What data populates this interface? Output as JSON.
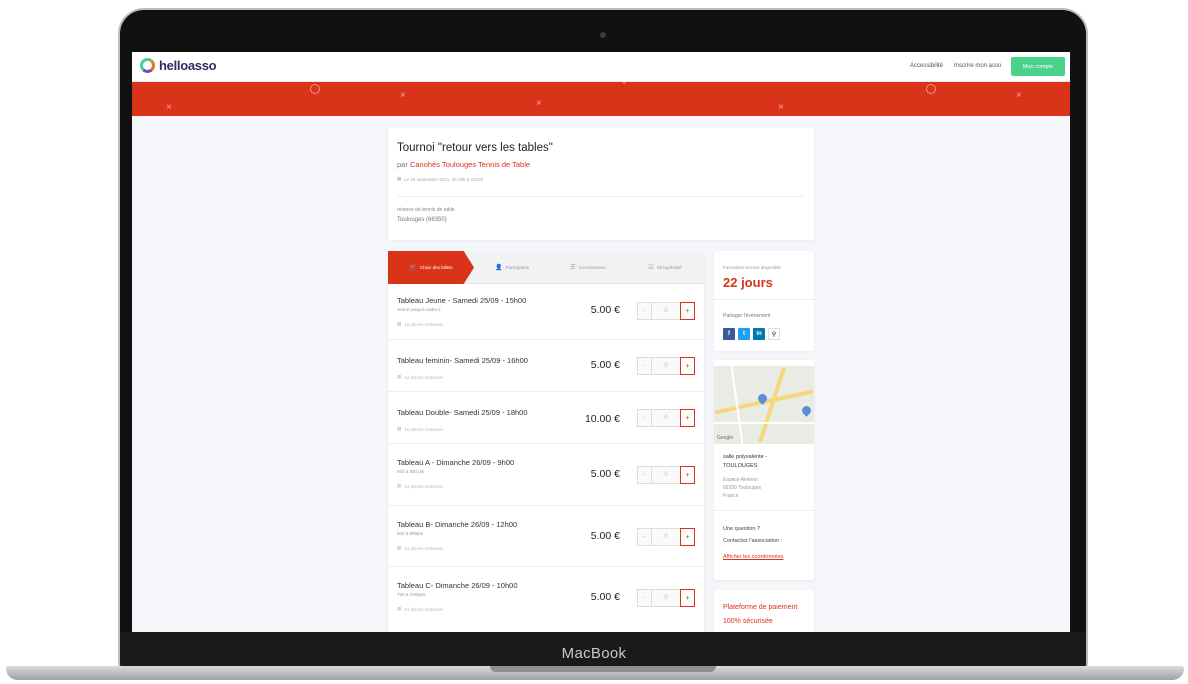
{
  "device": {
    "label": "MacBook"
  },
  "header": {
    "logo_text": "helloasso",
    "links": [
      "Accessibilité",
      "Inscrire mon asso"
    ],
    "account_button": "Mon compte"
  },
  "event": {
    "title": "Tournoi \"retour vers les tables\"",
    "organizer_prefix": "par",
    "organizer": "Canohès Toulouges Tennis de Table",
    "date": "Le 25 septembre 2021, de 09h à 23h30",
    "venue_line1": "réserve de tennis de table",
    "venue_line2": "Toulouges (66350)"
  },
  "tabs": [
    {
      "label": "Choix des billets",
      "icon": "cart-icon"
    },
    {
      "label": "Participants",
      "icon": "user-icon"
    },
    {
      "label": "Coordonnées",
      "icon": "list-icon"
    },
    {
      "label": "Récapitulatif",
      "icon": "check-icon"
    }
  ],
  "tickets": [
    {
      "name": "Tableau Jeune - Samedi 25/09 - 15h00",
      "sub": "Jeune jusqu'à cadet 2",
      "remaining": "16 places restantes",
      "price": "5.00 €",
      "qty": "0"
    },
    {
      "name": "Tableau feminin- Samedi 25/09 - 16h00",
      "sub": "",
      "remaining": "12 places restantes",
      "price": "5.00 €",
      "qty": "0"
    },
    {
      "name": "Tableau Double- Samedi 25/09 - 18h00",
      "sub": "",
      "remaining": "16 places restantes",
      "price": "10.00 €",
      "qty": "0"
    },
    {
      "name": "Tableau A - Dimanche 26/09 - 9h00",
      "sub": "500 à 800 pts",
      "remaining": "24 places restantes",
      "price": "5.00 €",
      "qty": "0"
    },
    {
      "name": "Tableau B- Dimanche 26/09 - 12h00",
      "sub": "500 à 999pts",
      "remaining": "24 places restantes",
      "price": "5.00 €",
      "qty": "0"
    },
    {
      "name": "Tableau C- Dimanche 26/09 - 10h00",
      "sub": "750 à 1099pts",
      "remaining": "24 places restantes",
      "price": "5.00 €",
      "qty": "0"
    }
  ],
  "sidebar": {
    "days_label": "Formulaire encore disponible",
    "days_value": "22 jours",
    "share_label": "Partager l'événement",
    "share_buttons": [
      {
        "label": "f",
        "name": "facebook-icon",
        "color": "#3b5998"
      },
      {
        "label": "t",
        "name": "twitter-icon",
        "color": "#1da1f2"
      },
      {
        "label": "in",
        "name": "linkedin-icon",
        "color": "#0077b5"
      },
      {
        "label": "⚲",
        "name": "link-icon",
        "color": "#ffffff"
      }
    ],
    "map_google": "Google",
    "venue_name": "salle polyvalente -",
    "venue_city": "TOULOUGES",
    "venue_addr": [
      "Espace Aletenri",
      "66350 Toulouges",
      "France"
    ],
    "question": "Une question ?",
    "contact_text": "Contactez l'association :",
    "contact_link": "Afficher les coordonnées",
    "secure_line1": "Plateforme de paiement",
    "secure_line2": "100% sécurisée"
  },
  "colors": {
    "accent": "#d9331a",
    "account": "#49d38a",
    "background": "#f4f6fa"
  }
}
